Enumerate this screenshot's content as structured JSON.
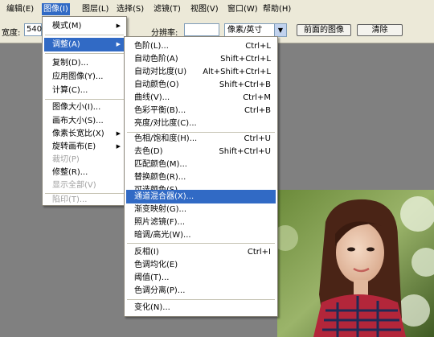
{
  "menubar": {
    "items": [
      "编辑(E)",
      "图像(I)",
      "图层(L)",
      "选择(S)",
      "滤镜(T)",
      "视图(V)",
      "窗口(W)",
      "帮助(H)"
    ]
  },
  "options": {
    "width_label": "宽度:",
    "width_value": "540",
    "resolution_label": "分辨率:",
    "resolution_value": "",
    "unit_value": "像素/英寸",
    "front_image_button": "前面的图像",
    "clear_button": "清除"
  },
  "image_menu": {
    "items": [
      {
        "label": "模式(M)",
        "submenu": true,
        "enabled": true
      },
      {
        "label": "调整(A)",
        "submenu": true,
        "enabled": true,
        "highlighted": true
      },
      {
        "label": "复制(D)...",
        "enabled": true
      },
      {
        "label": "应用图像(Y)...",
        "enabled": true
      },
      {
        "label": "计算(C)...",
        "enabled": true
      },
      {
        "label": "图像大小(I)...",
        "enabled": true
      },
      {
        "label": "画布大小(S)...",
        "enabled": true
      },
      {
        "label": "像素长宽比(X)",
        "submenu": true,
        "enabled": true
      },
      {
        "label": "旋转画布(E)",
        "submenu": true,
        "enabled": true
      },
      {
        "label": "裁切(P)",
        "enabled": false
      },
      {
        "label": "修整(R)...",
        "enabled": true
      },
      {
        "label": "显示全部(V)",
        "enabled": false
      },
      {
        "label": "陷印(T)...",
        "enabled": false
      }
    ]
  },
  "adjust_menu": {
    "items": [
      {
        "label": "色阶(L)...",
        "shortcut": "Ctrl+L"
      },
      {
        "label": "自动色阶(A)",
        "shortcut": "Shift+Ctrl+L"
      },
      {
        "label": "自动对比度(U)",
        "shortcut": "Alt+Shift+Ctrl+L"
      },
      {
        "label": "自动颜色(O)",
        "shortcut": "Shift+Ctrl+B"
      },
      {
        "label": "曲线(V)...",
        "shortcut": "Ctrl+M"
      },
      {
        "label": "色彩平衡(B)...",
        "shortcut": "Ctrl+B"
      },
      {
        "label": "亮度/对比度(C)...",
        "shortcut": ""
      },
      {
        "label": "色相/饱和度(H)...",
        "shortcut": "Ctrl+U"
      },
      {
        "label": "去色(D)",
        "shortcut": "Shift+Ctrl+U"
      },
      {
        "label": "匹配颜色(M)...",
        "shortcut": ""
      },
      {
        "label": "替换颜色(R)...",
        "shortcut": ""
      },
      {
        "label": "可选颜色(S)...",
        "shortcut": ""
      },
      {
        "label": "通道混合器(X)...",
        "shortcut": "",
        "highlighted": true
      },
      {
        "label": "渐变映射(G)...",
        "shortcut": ""
      },
      {
        "label": "照片滤镜(F)...",
        "shortcut": ""
      },
      {
        "label": "暗调/高光(W)...",
        "shortcut": ""
      },
      {
        "label": "反相(I)",
        "shortcut": "Ctrl+I"
      },
      {
        "label": "色调均化(E)",
        "shortcut": ""
      },
      {
        "label": "阈值(T)...",
        "shortcut": ""
      },
      {
        "label": "色调分离(P)...",
        "shortcut": ""
      },
      {
        "label": "变化(N)...",
        "shortcut": ""
      }
    ]
  },
  "colors": {
    "menubar_bg": "#ece9d8",
    "highlight": "#316ac5",
    "workspace": "#808080"
  }
}
